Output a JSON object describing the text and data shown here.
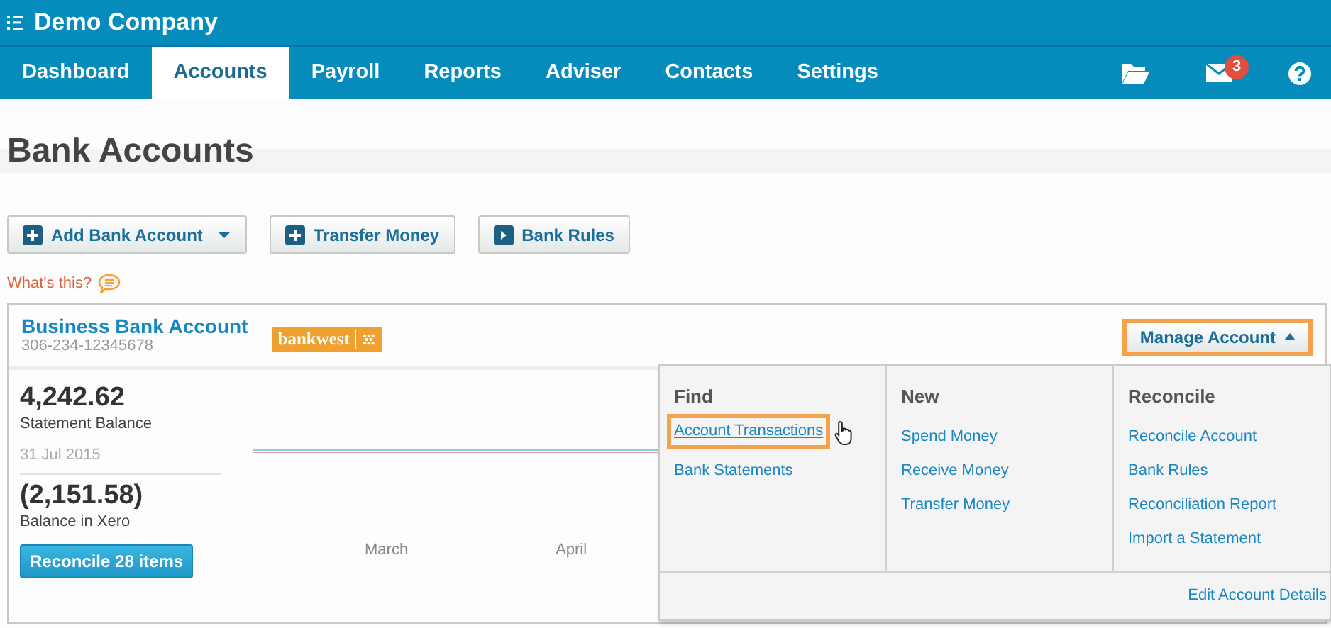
{
  "company": {
    "name": "Demo Company"
  },
  "nav": {
    "tabs": [
      {
        "label": "Dashboard",
        "selected": false
      },
      {
        "label": "Accounts",
        "selected": true
      },
      {
        "label": "Payroll",
        "selected": false
      },
      {
        "label": "Reports",
        "selected": false
      },
      {
        "label": "Adviser",
        "selected": false
      },
      {
        "label": "Contacts",
        "selected": false
      },
      {
        "label": "Settings",
        "selected": false
      }
    ],
    "mail_badge": "3"
  },
  "page_title": "Bank Accounts",
  "toolbar": [
    {
      "label": "Add Bank Account",
      "kind": "plus",
      "dropdown": true
    },
    {
      "label": "Transfer Money",
      "kind": "plus",
      "dropdown": false
    },
    {
      "label": "Bank Rules",
      "kind": "play",
      "dropdown": false
    }
  ],
  "help_link": "What's this?",
  "account": {
    "name": "Business Bank Account",
    "number": "306-234-12345678",
    "bank_logo": "bankwest",
    "manage_button": {
      "label": "Manage Account",
      "highlighted": true,
      "expanded": true
    },
    "statement_balance": "4,242.62",
    "statement_label": "Statement Balance",
    "statement_date": "31 Jul 2015",
    "xero_balance": "(2,151.58)",
    "xero_label": "Balance in Xero",
    "reconcile_button": "Reconcile 28 items",
    "chart": {
      "month_labels": [
        "March",
        "April"
      ]
    }
  },
  "menu": {
    "columns": [
      {
        "heading": "Find",
        "items": [
          {
            "label": "Account Transactions",
            "highlighted": true
          },
          {
            "label": "Bank Statements",
            "highlighted": false
          }
        ]
      },
      {
        "heading": "New",
        "items": [
          {
            "label": "Spend Money",
            "highlighted": false
          },
          {
            "label": "Receive Money",
            "highlighted": false
          },
          {
            "label": "Transfer Money",
            "highlighted": false
          }
        ]
      },
      {
        "heading": "Reconcile",
        "items": [
          {
            "label": "Reconcile Account",
            "highlighted": false
          },
          {
            "label": "Bank Rules",
            "highlighted": false
          },
          {
            "label": "Reconciliation Report",
            "highlighted": false
          },
          {
            "label": "Import a Statement",
            "highlighted": false
          }
        ]
      }
    ],
    "footer_link": "Edit Account Details"
  }
}
